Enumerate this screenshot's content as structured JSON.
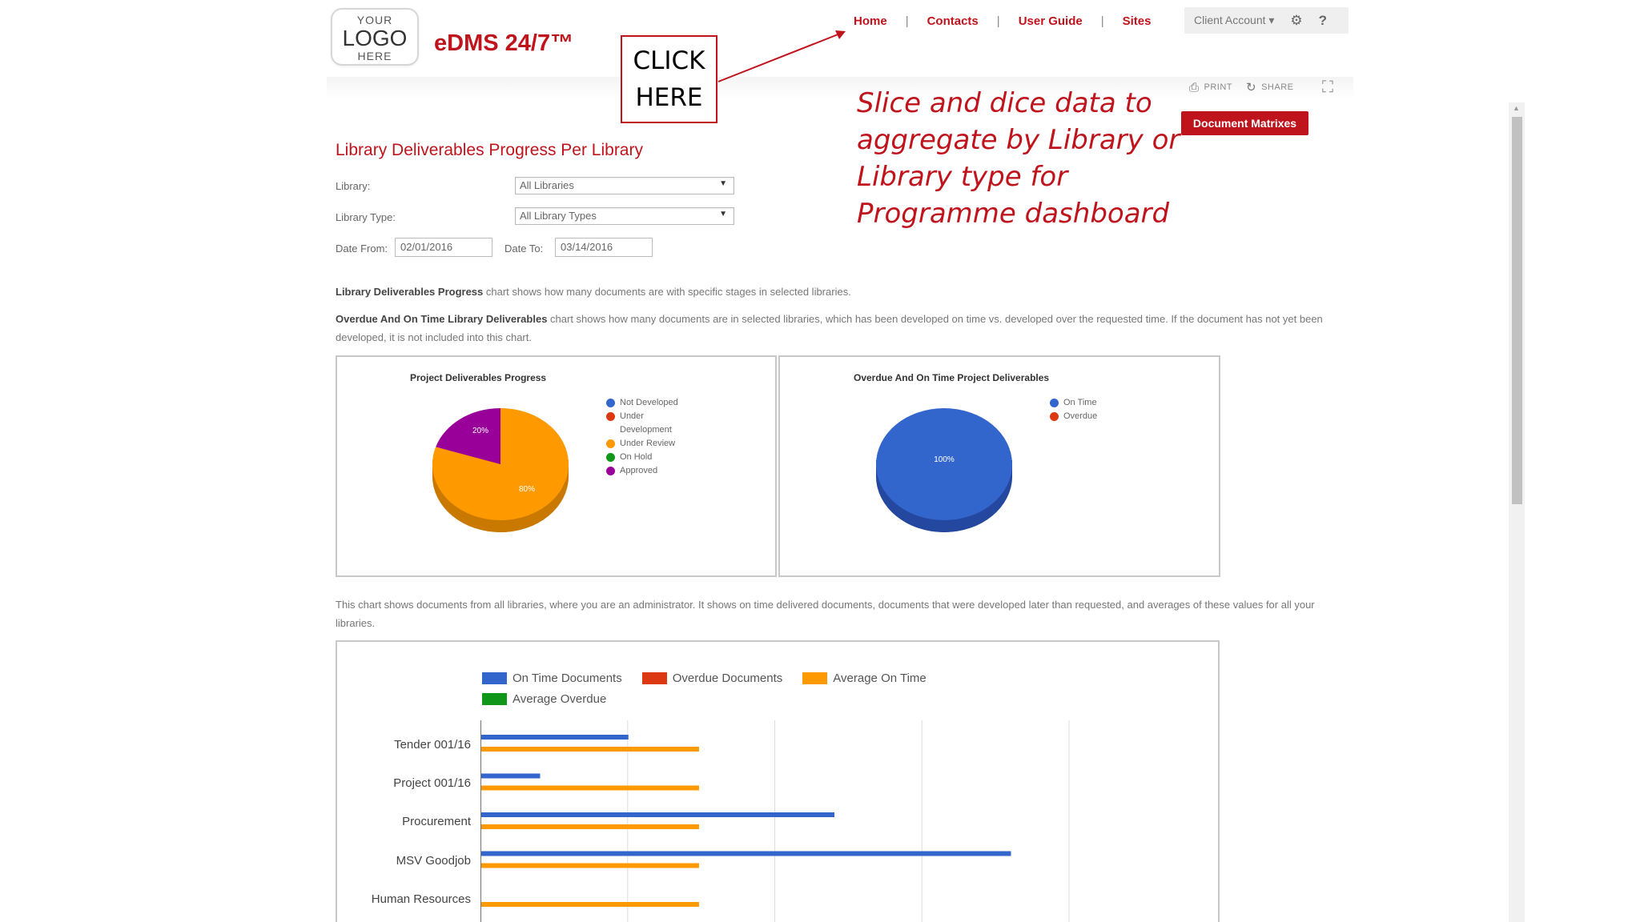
{
  "logo": {
    "line1": "YOUR",
    "line2": "LOGO",
    "line3": "HERE"
  },
  "brand": "eDMS 24/7™",
  "nav": {
    "items": [
      "Home",
      "Contacts",
      "User Guide",
      "Sites"
    ],
    "separator": "|",
    "account": "Client Account ▾",
    "settings_icon": "⚙",
    "help_icon": "?"
  },
  "callout": {
    "click_line1": "CLICK",
    "click_line2": "HERE",
    "text": "Slice and dice data to aggregate by Library or Library type for Programme dashboard",
    "color": "#c0141d"
  },
  "tools": {
    "print": "PRINT",
    "share": "SHARE"
  },
  "document_matrixes_button": "Document Matrixes",
  "page_title": "Library Deliverables Progress Per Library",
  "filters": {
    "library_label": "Library:",
    "library_value": "All Libraries",
    "library_type_label": "Library Type:",
    "library_type_value": "All Library Types",
    "date_from_label": "Date From:",
    "date_from_value": "02/01/2016",
    "date_to_label": "Date To:",
    "date_to_value": "03/14/2016"
  },
  "descriptions": {
    "progress_bold": "Library Deliverables Progress",
    "progress_text": " chart shows how many documents are with specific stages in selected libraries.",
    "overdue_bold": "Overdue And On Time Library Deliverables",
    "overdue_text": " chart shows how many documents are in selected libraries, which has been developed on time vs. developed over the requested time. If the document has not yet been developed, it is not included into this chart.",
    "bar_text": "This chart shows documents from all libraries, where you are an administrator. It shows on time delivered documents, documents that were developed later than requested, and averages of these values for all your libraries."
  },
  "chart_data": [
    {
      "type": "pie",
      "title": "Project Deliverables Progress",
      "labels": [
        "Not Developed",
        "Under Development",
        "Under Review",
        "On Hold",
        "Approved"
      ],
      "values": [
        0,
        0,
        80,
        0,
        20
      ],
      "value_labels": [
        "80%",
        "20%"
      ],
      "colors": [
        "#3366cc",
        "#dc3912",
        "#ff9900",
        "#109618",
        "#990099"
      ],
      "legend_position": "right",
      "style": "3d"
    },
    {
      "type": "pie",
      "title": "Overdue And On Time Project Deliverables",
      "labels": [
        "On Time",
        "Overdue"
      ],
      "values": [
        100,
        0
      ],
      "value_labels": [
        "100%"
      ],
      "colors": [
        "#3366cc",
        "#dc3912"
      ],
      "legend_position": "right",
      "style": "3d"
    },
    {
      "type": "bar",
      "orientation": "horizontal",
      "categories": [
        "Tender 001/16",
        "Project 001/16",
        "Procurement",
        "MSV Goodjob",
        "Human Resources"
      ],
      "series": [
        {
          "name": "On Time Documents",
          "color": "#3366cc",
          "values": [
            5,
            2,
            12,
            18,
            0
          ]
        },
        {
          "name": "Overdue Documents",
          "color": "#dc3912",
          "values": [
            0,
            0,
            0,
            0,
            0
          ]
        },
        {
          "name": "Average On Time",
          "color": "#ff9900",
          "values": [
            7.4,
            7.4,
            7.4,
            7.4,
            7.4
          ]
        },
        {
          "name": "Average Overdue",
          "color": "#109618",
          "values": [
            0,
            0,
            0,
            0,
            0
          ]
        }
      ],
      "xlim": [
        0,
        20
      ],
      "gridlines": true,
      "legend_position": "top"
    }
  ]
}
